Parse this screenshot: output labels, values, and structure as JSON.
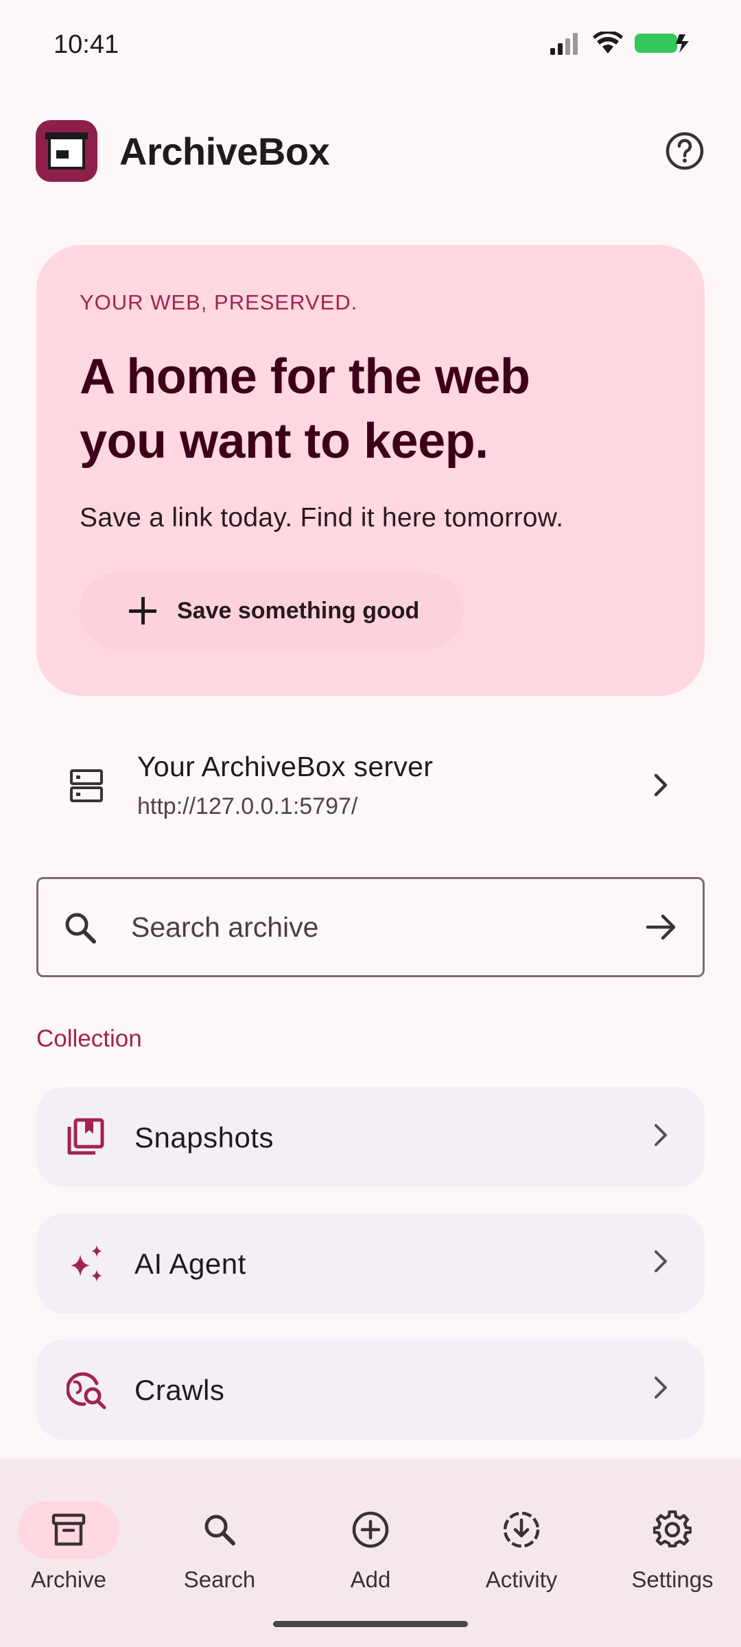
{
  "status_bar": {
    "time": "10:41"
  },
  "app_bar": {
    "title": "ArchiveBox",
    "logo_icon": "archive-box-logo",
    "help_icon": "help-circle-icon"
  },
  "hero": {
    "eyebrow": "YOUR WEB, PRESERVED.",
    "headline": "A home for the web you want to keep.",
    "subtitle": "Save a link today. Find it here tomorrow.",
    "button_label": "Save something good"
  },
  "server": {
    "title": "Your ArchiveBox server",
    "url": "http://127.0.0.1:5797/"
  },
  "search": {
    "placeholder": "Search archive",
    "value": ""
  },
  "collection": {
    "section_label": "Collection",
    "items": [
      {
        "label": "Snapshots",
        "icon": "bookmarks-icon"
      },
      {
        "label": "AI Agent",
        "icon": "sparkle-icon"
      },
      {
        "label": "Crawls",
        "icon": "travel-explore-icon"
      }
    ]
  },
  "bottom_nav": {
    "items": [
      {
        "label": "Archive",
        "icon": "archive-icon",
        "active": true
      },
      {
        "label": "Search",
        "icon": "search-icon",
        "active": false
      },
      {
        "label": "Add",
        "icon": "add-circle-icon",
        "active": false
      },
      {
        "label": "Activity",
        "icon": "activity-icon",
        "active": false
      },
      {
        "label": "Settings",
        "icon": "gear-icon",
        "active": false
      }
    ]
  },
  "colors": {
    "accent": "#a2234f",
    "hero_background": "#ffd8e1",
    "hero_text": "#3d0019",
    "card_background": "#f4eff6",
    "nav_background": "#f5e8ec",
    "battery": "#34c759"
  }
}
